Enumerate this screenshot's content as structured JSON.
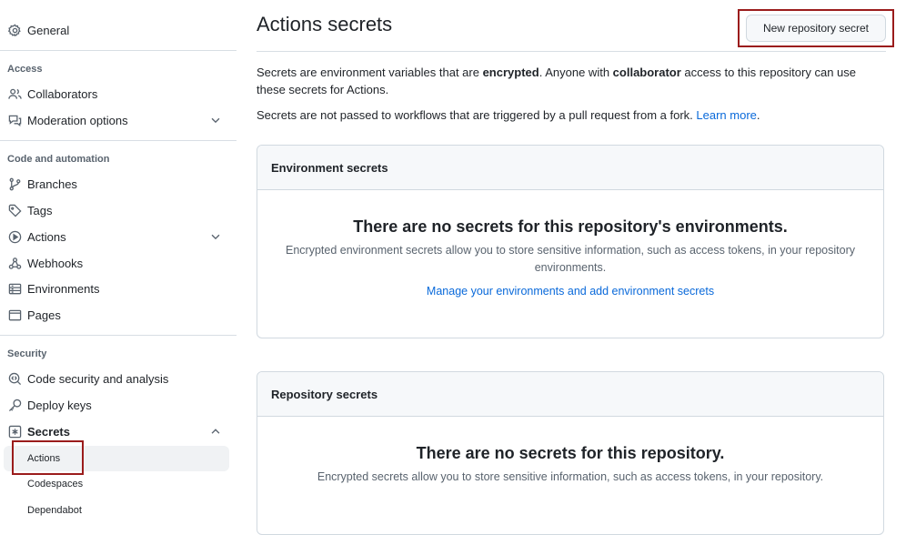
{
  "sidebar": {
    "general": "General",
    "sections": {
      "access": "Access",
      "code_automation": "Code and automation",
      "security": "Security"
    },
    "items": {
      "collaborators": "Collaborators",
      "moderation": "Moderation options",
      "branches": "Branches",
      "tags": "Tags",
      "actions": "Actions",
      "webhooks": "Webhooks",
      "environments": "Environments",
      "pages": "Pages",
      "code_security": "Code security and analysis",
      "deploy_keys": "Deploy keys",
      "secrets": "Secrets"
    },
    "secrets_sub": {
      "actions": "Actions",
      "codespaces": "Codespaces",
      "dependabot": "Dependabot"
    }
  },
  "main": {
    "title": "Actions secrets",
    "new_button": "New repository secret",
    "intro": {
      "part1": "Secrets are environment variables that are ",
      "bold1": "encrypted",
      "part2": ". Anyone with ",
      "bold2": "collaborator",
      "part3": " access to this repository can use these secrets for Actions."
    },
    "note": {
      "text": "Secrets are not passed to workflows that are triggered by a pull request from a fork. ",
      "link": "Learn more",
      "end": "."
    },
    "env_box": {
      "header": "Environment secrets",
      "empty_title": "There are no secrets for this repository's environments.",
      "empty_desc": "Encrypted environment secrets allow you to store sensitive information, such as access tokens, in your repository environments.",
      "link": "Manage your environments and add environment secrets"
    },
    "repo_box": {
      "header": "Repository secrets",
      "empty_title": "There are no secrets for this repository.",
      "empty_desc": "Encrypted secrets allow you to store sensitive information, such as access tokens, in your repository."
    }
  },
  "colors": {
    "highlight": "#9b1c1c",
    "link": "#0969da",
    "muted": "#59636e"
  }
}
